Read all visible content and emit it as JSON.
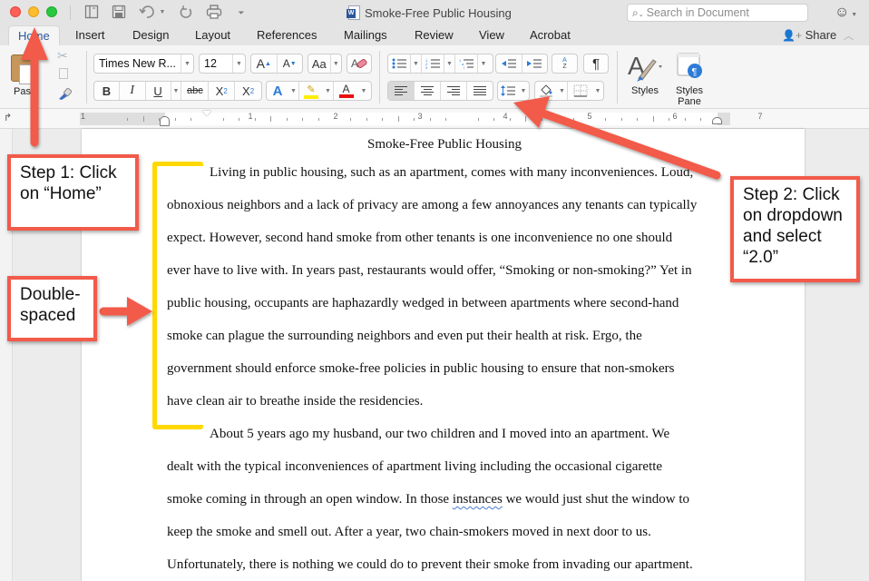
{
  "window": {
    "document_title": "Smoke-Free Public Housing",
    "search_placeholder": "Search in Document"
  },
  "quick_access": [
    "sidebar-icon",
    "save-icon",
    "undo-icon",
    "redo-icon",
    "print-icon",
    "customize-icon"
  ],
  "tabs": [
    {
      "label": "Home",
      "active": true
    },
    {
      "label": "Insert"
    },
    {
      "label": "Design"
    },
    {
      "label": "Layout"
    },
    {
      "label": "References"
    },
    {
      "label": "Mailings"
    },
    {
      "label": "Review"
    },
    {
      "label": "View"
    },
    {
      "label": "Acrobat"
    }
  ],
  "share_label": "Share",
  "ribbon": {
    "paste_label": "Paste",
    "font_name": "Times New R...",
    "font_size": "12",
    "grow_font": "A",
    "shrink_font": "A",
    "change_case": "Aa",
    "bold": "B",
    "italic": "I",
    "underline": "U",
    "strikethrough": "abc",
    "subscript": "X",
    "subscript_mark": "2",
    "superscript": "X",
    "superscript_mark": "2",
    "text_effects": "A",
    "font_color": "A",
    "pilcrow": "¶",
    "sort_a": "A",
    "sort_z": "Z",
    "styles_label": "Styles",
    "styles_pane_label_1": "Styles",
    "styles_pane_label_2": "Pane",
    "alignment_active": "left",
    "highlight_color": "#ffee00",
    "font_color_value": "#e81010"
  },
  "ruler": {
    "labels": [
      "1",
      "1",
      "2",
      "3",
      "4",
      "5",
      "6",
      "7"
    ]
  },
  "document": {
    "heading": "Smoke-Free Public Housing",
    "paragraph1": [
      "Living in public housing, such as an apartment, comes with many inconveniences. Loud,",
      "obnoxious neighbors and a lack of privacy are among a few annoyances any tenants can typically",
      "expect. However, second hand smoke from other tenants is one inconvenience no one should",
      "ever have to live with. In years past, restaurants would offer, “Smoking or non-smoking?” Yet in",
      "public housing, occupants are haphazardly wedged in between apartments where second-hand",
      "smoke can plague the surrounding neighbors and even put their health at risk. Ergo, the",
      "government should enforce smoke-free policies in public housing to ensure that non-smokers",
      "have clean air to breathe inside the residencies."
    ],
    "paragraph2": [
      "About 5 years ago my husband, our two children and I moved into an apartment. We",
      "dealt with the typical inconveniences of apartment living including the occasional cigarette",
      "smoke coming in through an open window. In those ",
      "instances",
      " we would just shut the window to",
      "keep the smoke and smell out. After a year, two chain-smokers moved in next door to us.",
      "Unfortunately, there is nothing we could do to prevent their smoke from invading our apartment."
    ]
  },
  "annotations": {
    "step1": [
      "Step 1: Click",
      "on “Home”"
    ],
    "double_spaced": [
      "Double-",
      "spaced"
    ],
    "step2": [
      "Step 2: Click",
      "on dropdown",
      "and select",
      "“2.0”"
    ],
    "arrow_color": "#f25a4a",
    "bracket_color": "#ffd800"
  }
}
